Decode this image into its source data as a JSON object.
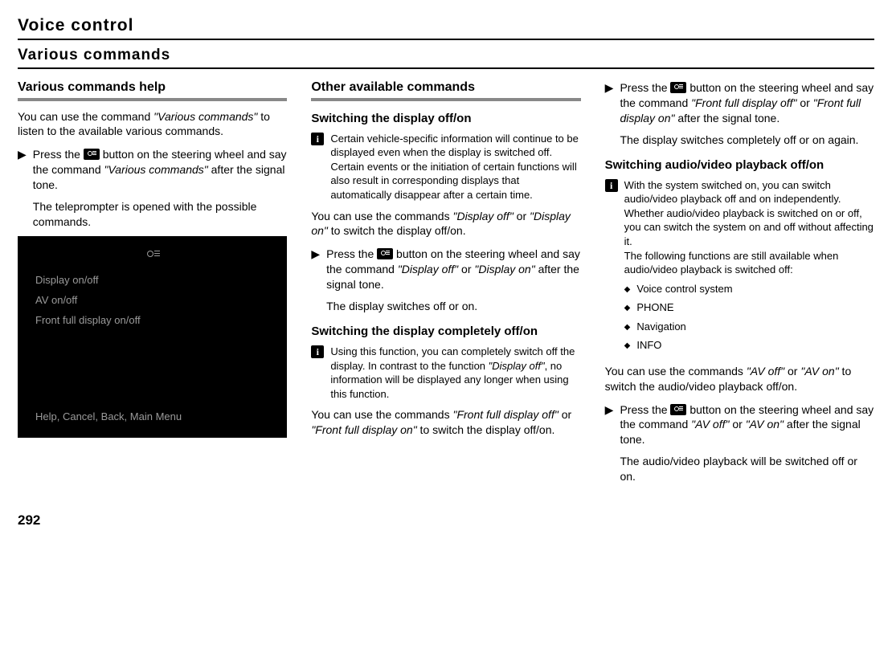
{
  "page": {
    "header": "Voice control",
    "section": "Various commands",
    "number": "292"
  },
  "col1": {
    "heading": "Various commands help",
    "intro_pre": "You can use the command ",
    "intro_cmd": "\"Various commands\"",
    "intro_post": " to listen to the available various commands.",
    "step_pre": "Press the ",
    "step_mid": " button on the steering wheel and say the command ",
    "step_cmd": "\"Various commands\"",
    "step_post": " after the signal tone.",
    "result": "The teleprompter is opened with the possible commands.",
    "screenshot": {
      "items": [
        "Display on/off",
        "AV on/off",
        "Front full display on/off"
      ],
      "footer": "Help, Cancel, Back, Main Menu"
    }
  },
  "col2": {
    "heading": "Other available commands",
    "s1_title": "Switching the display off/on",
    "s1_info": "Certain vehicle-specific information will continue to be displayed even when the display is switched off. Certain events or the initiation of certain functions will also result in corresponding displays that automatically disappear after a certain time.",
    "s1_intro_pre": "You can use the commands ",
    "s1_intro_cmd1": "\"Display off\"",
    "s1_intro_mid": " or ",
    "s1_intro_cmd2": "\"Display on\"",
    "s1_intro_post": " to switch the display off/on.",
    "s1_step_pre": "Press the ",
    "s1_step_mid": " button on the steering wheel and say the command ",
    "s1_step_cmd1": "\"Display off\"",
    "s1_step_mid2": " or ",
    "s1_step_cmd2": "\"Display on\"",
    "s1_step_post": " after the signal tone.",
    "s1_result": "The display switches off or on.",
    "s2_title": "Switching the display completely off/on",
    "s2_info_pre": "Using this function, you can completely switch off the display. In contrast to the function ",
    "s2_info_cmd": "\"Display off\"",
    "s2_info_post": ", no information will be displayed any longer when using this function.",
    "s2_intro_pre": "You can use the commands ",
    "s2_intro_cmd1": "\"Front full display off\"",
    "s2_intro_mid": " or ",
    "s2_intro_cmd2": "\"Front full display on\"",
    "s2_intro_post": " to switch the display off/on."
  },
  "col3": {
    "s2_step_pre": "Press the ",
    "s2_step_mid": " button on the steering wheel and say the command ",
    "s2_step_cmd1": "\"Front full display off\"",
    "s2_step_mid2": " or ",
    "s2_step_cmd2": "\"Front full display on\"",
    "s2_step_post": " after the signal tone.",
    "s2_result": "The display switches completely off or on again.",
    "s3_title": "Switching audio/video playback off/on",
    "s3_info1": "With the system switched on, you can switch audio/video playback off and on independently. Whether audio/video playback is switched on or off, you can switch the system on and off without affecting it.",
    "s3_info2": "The following functions are still available when audio/video playback is switched off:",
    "s3_bullets": [
      "Voice control system",
      "PHONE",
      "Navigation",
      "INFO"
    ],
    "s3_intro_pre": "You can use the commands ",
    "s3_intro_cmd1": "\"AV off\"",
    "s3_intro_mid": " or ",
    "s3_intro_cmd2": "\"AV on\"",
    "s3_intro_post": " to switch the audio/video playback off/on.",
    "s3_step_pre": "Press the ",
    "s3_step_mid": " button on the steering wheel and say the command ",
    "s3_step_cmd1": "\"AV off\"",
    "s3_step_mid2": " or ",
    "s3_step_cmd2": "\"AV on\"",
    "s3_step_post": " after the signal tone.",
    "s3_result": "The audio/video playback will be switched off or on."
  }
}
